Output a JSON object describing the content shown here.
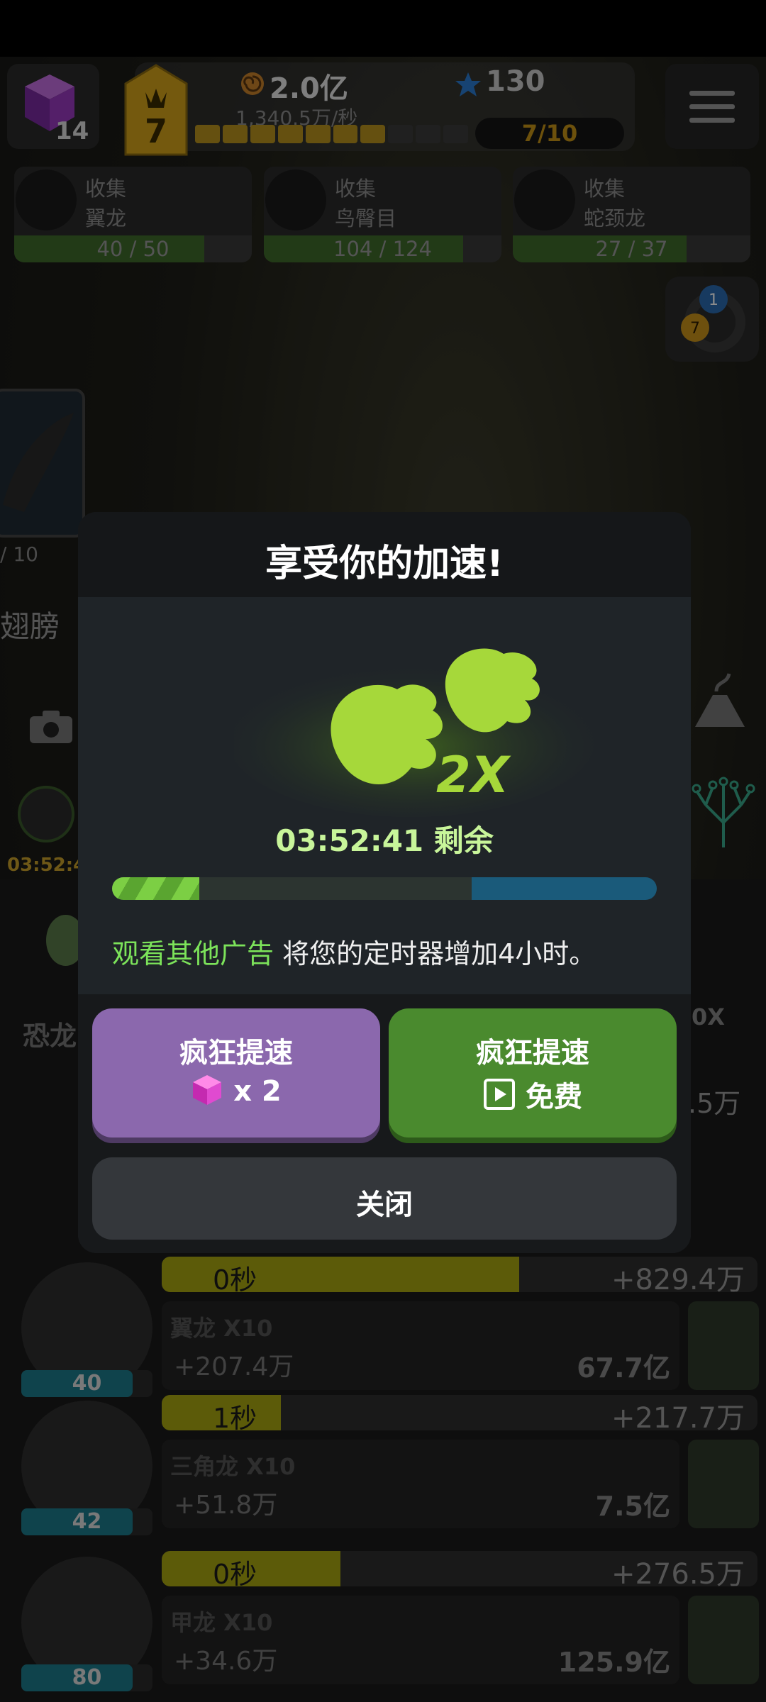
{
  "hud": {
    "cube_count": "14",
    "level": "7",
    "gold": "2.0亿",
    "gold_rate": "1,340.5万/秒",
    "gems": "130",
    "level_progress": "7/10",
    "level_segments_filled": 7,
    "level_segments_total": 10
  },
  "collections": [
    {
      "label": "收集",
      "name": "翼龙",
      "progress": "40 / 50",
      "ratio": 0.8
    },
    {
      "label": "收集",
      "name": "鸟臀目",
      "progress": "104 / 124",
      "ratio": 0.84
    },
    {
      "label": "收集",
      "name": "蛇颈龙",
      "progress": "27 / 37",
      "ratio": 0.73
    }
  ],
  "notifications": {
    "blue": "1",
    "gold": "7"
  },
  "left_panel": {
    "wing_count": "/ 10",
    "wing_label": "翅膀",
    "speed_timer": "03:52:4",
    "dino_tab": "恐龙"
  },
  "right_panel": {
    "multiplier": "0X",
    "earn_partial": ".5万"
  },
  "rows": [
    {
      "level": "40",
      "level_ratio": 0.85,
      "prog_time": "0秒",
      "prog_ratio": 0.6,
      "earn_prefix": "+",
      "earn": "829.4万",
      "name": "翼龙  X10",
      "gain": "+207.4万",
      "cost": "67.7亿"
    },
    {
      "level": "42",
      "level_ratio": 0.85,
      "prog_time": "1秒",
      "prog_ratio": 0.2,
      "earn_prefix": "+",
      "earn": "217.7万",
      "name": "三角龙  X10",
      "gain": "+51.8万",
      "cost": "7.5亿"
    },
    {
      "level": "80",
      "level_ratio": 0.85,
      "prog_time": "0秒",
      "prog_ratio": 0.3,
      "earn_prefix": "+",
      "earn": "276.5万",
      "name": "甲龙  X10",
      "gain": "+34.6万",
      "cost": "125.9亿"
    }
  ],
  "modal": {
    "title": "享受你的加速!",
    "badge": "2X",
    "timer": "03:52:41 剩余",
    "timer_ratio": 0.16,
    "elapsed_ratio": 0.66,
    "note_highlight": "观看其他广告",
    "note_rest": " 将您的定时器增加4小时。",
    "btn_gem_title": "疯狂提速",
    "btn_gem_cost": "x 2",
    "btn_ad_title": "疯狂提速",
    "btn_ad_cost": "免费",
    "close_label": "关闭"
  },
  "colors": {
    "accent_green": "#7ce35a",
    "purple_button": "#8b68ad",
    "green_button": "#4a8a2e",
    "gold": "#c69416"
  }
}
